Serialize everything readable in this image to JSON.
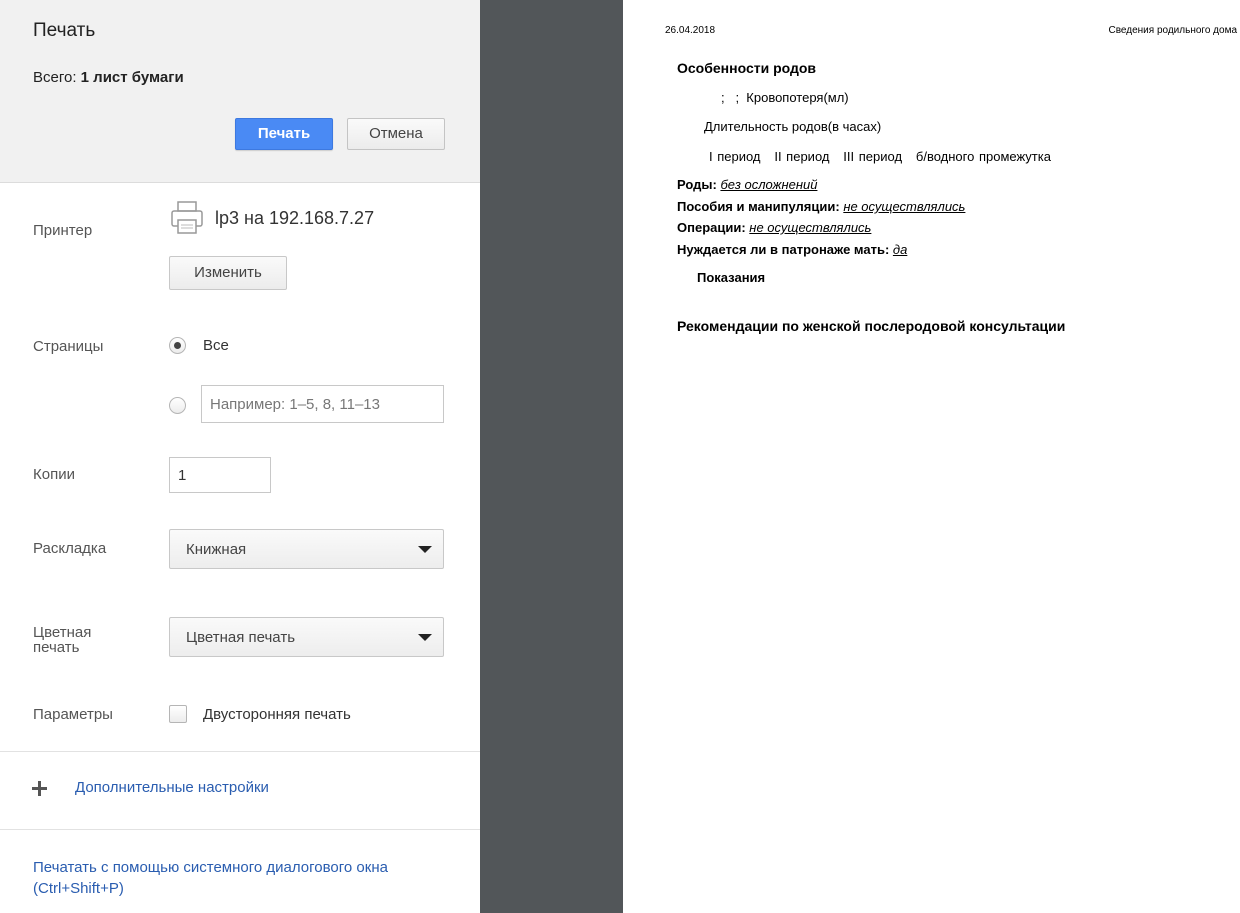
{
  "dialog": {
    "title": "Печать",
    "summary_prefix": "Всего: ",
    "summary_value": "1 лист бумаги",
    "print_label": "Печать",
    "cancel_label": "Отмена"
  },
  "printer": {
    "label": "Принтер",
    "name": "lp3 на 192.168.7.27",
    "change_label": "Изменить"
  },
  "pages": {
    "label": "Страницы",
    "all_label": "Все",
    "selected": "all",
    "custom_placeholder": "Например: 1–5, 8, 11–13"
  },
  "copies": {
    "label": "Копии",
    "value": "1"
  },
  "layout": {
    "label": "Раскладка",
    "value": "Книжная"
  },
  "color": {
    "label": "Цветная печать",
    "value": "Цветная печать"
  },
  "options": {
    "label": "Параметры",
    "duplex_label": "Двусторонняя печать",
    "duplex_checked": false
  },
  "more_settings_label": "Дополнительные настройки",
  "system_dialog_label": "Печатать с помощью системного диалогового окна (Ctrl+Shift+P)",
  "preview": {
    "date": "26.04.2018",
    "header_right": "Сведения родильного дома",
    "heading_birth": "Особенности родов",
    "blood_loss": ";   ;  Кровопотеря(мл)",
    "duration": "Длительность родов(в часах)",
    "periods": "I период   II период   III период   б/водного промежутка",
    "births_label": "Роды:",
    "births_value": "без осложнений",
    "aids_label": "Пособия и манипуляции:",
    "aids_value": "не осуществлялись",
    "ops_label": "Операции:",
    "ops_value": "не осуществлялись",
    "care_label": "Нуждается ли в патронаже мать:",
    "care_value": "да",
    "indications": "Показания",
    "recommendations": "Рекомендации по женской послеродовой консультации"
  },
  "colors": {
    "primary_button": "#4a8af4",
    "link": "#2a5db0",
    "preview_background": "#525659",
    "header_background": "#f1f1f1"
  }
}
